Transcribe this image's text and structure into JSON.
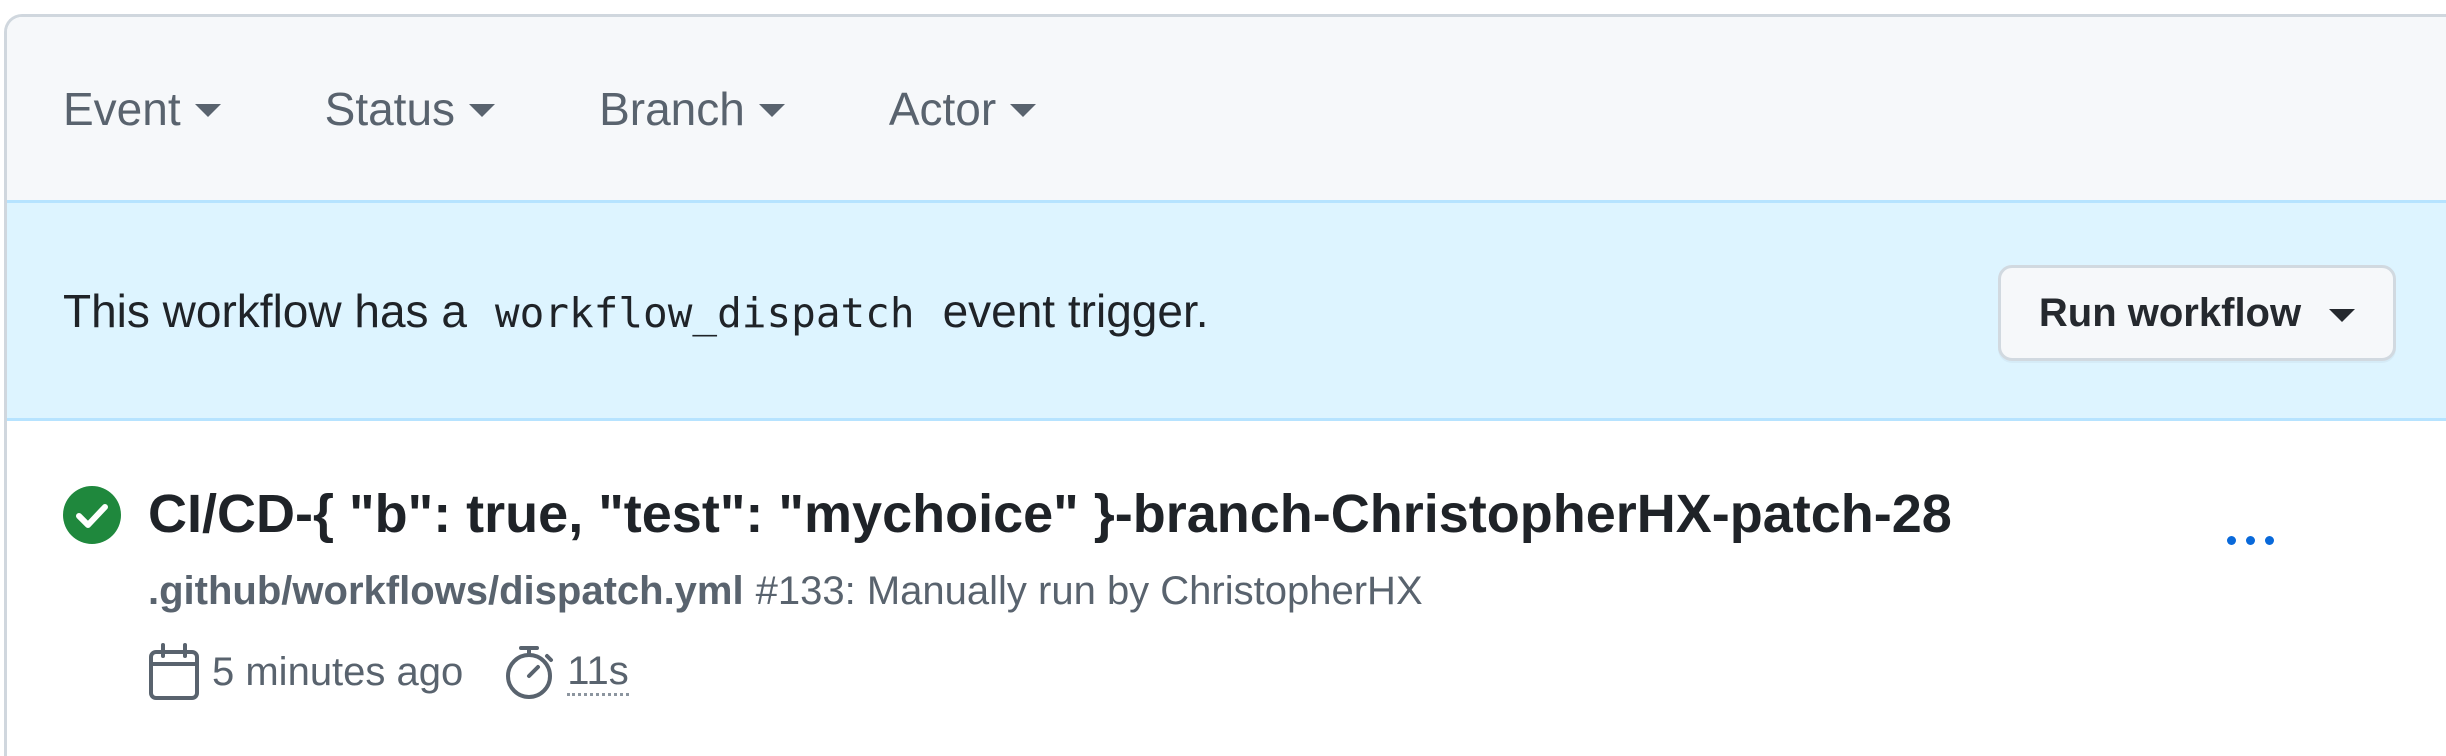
{
  "filters": [
    {
      "label": "Event"
    },
    {
      "label": "Status"
    },
    {
      "label": "Branch"
    },
    {
      "label": "Actor"
    }
  ],
  "dispatch": {
    "prefix": "This workflow has a",
    "code": "workflow_dispatch",
    "suffix": "event trigger.",
    "button_label": "Run workflow"
  },
  "run": {
    "title": "CI/CD-{ \"b\": true, \"test\": \"mychoice\" }-branch-ChristopherHX-patch-28",
    "workflow_file": ".github/workflows/dispatch.yml",
    "description": "#133: Manually run by ChristopherHX",
    "time_ago": "5 minutes ago",
    "duration": "11s",
    "status": "success",
    "status_color": "#1f883d"
  },
  "icons": {
    "status": "check-circle-fill-icon",
    "calendar": "calendar-icon",
    "duration": "stopwatch-icon",
    "more": "kebab-horizontal-icon"
  },
  "colors": {
    "banner_bg": "#ddf4ff",
    "filter_bar_bg": "#f6f8fa",
    "link_accent": "#0969da"
  }
}
